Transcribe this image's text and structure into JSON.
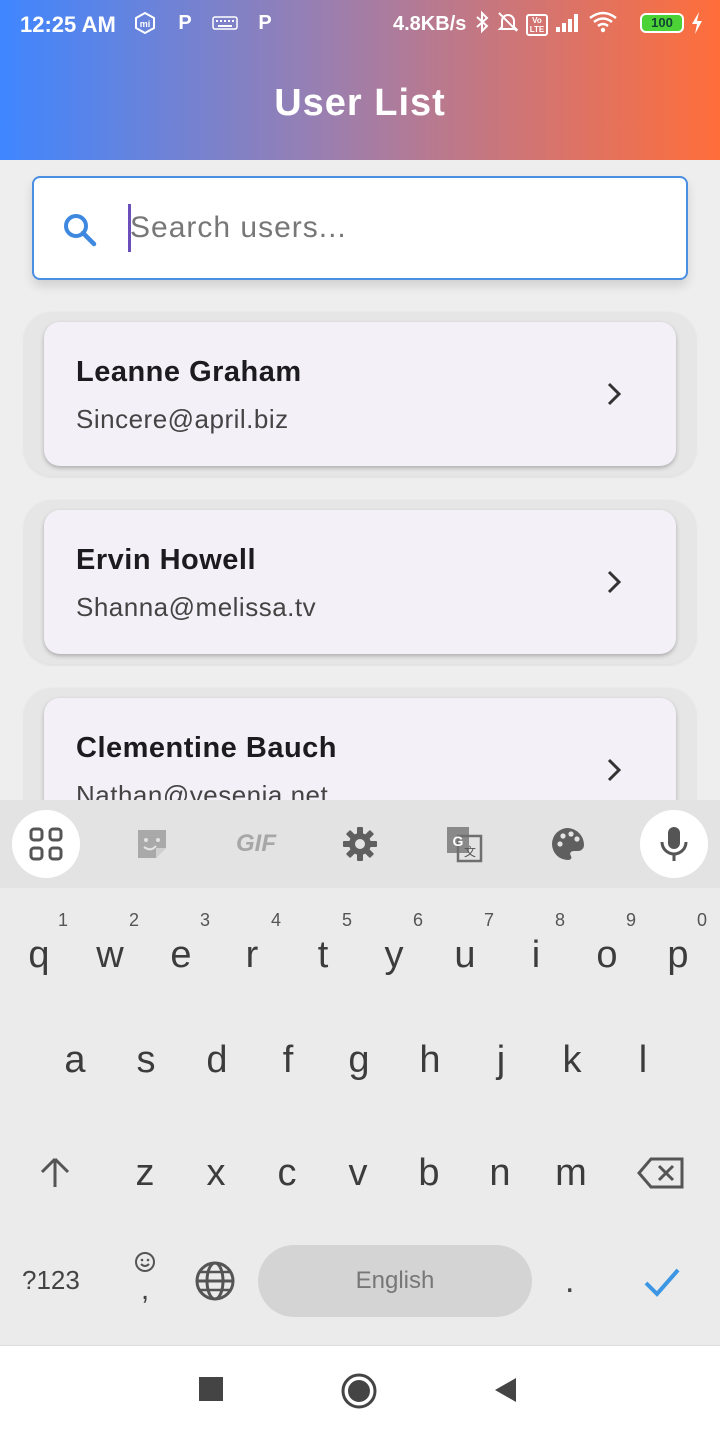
{
  "status_bar": {
    "time": "12:25 AM",
    "speed": "4.8KB/s",
    "battery": "100",
    "p_icon_1": "P",
    "p_icon_2": "P",
    "volte": "Vo LTE",
    "icons": [
      "mi-icon",
      "p-icon",
      "keyboard-icon",
      "p-icon",
      "bluetooth-icon",
      "mute-bell-icon",
      "volte-icon",
      "signal-icon",
      "wifi-icon",
      "battery-icon",
      "charging-icon"
    ]
  },
  "header": {
    "title": "User List"
  },
  "search": {
    "placeholder": "Search users..."
  },
  "users": [
    {
      "name": "Leanne Graham",
      "email": "Sincere@april.biz"
    },
    {
      "name": "Ervin Howell",
      "email": "Shanna@melissa.tv"
    },
    {
      "name": "Clementine Bauch",
      "email": "Nathan@yesenia.net"
    }
  ],
  "keyboard": {
    "toolbar": {
      "gif": "GIF"
    },
    "row1": [
      {
        "key": "q",
        "hint": "1"
      },
      {
        "key": "w",
        "hint": "2"
      },
      {
        "key": "e",
        "hint": "3"
      },
      {
        "key": "r",
        "hint": "4"
      },
      {
        "key": "t",
        "hint": "5"
      },
      {
        "key": "y",
        "hint": "6"
      },
      {
        "key": "u",
        "hint": "7"
      },
      {
        "key": "i",
        "hint": "8"
      },
      {
        "key": "o",
        "hint": "9"
      },
      {
        "key": "p",
        "hint": "0"
      }
    ],
    "row2": [
      "a",
      "s",
      "d",
      "f",
      "g",
      "h",
      "j",
      "k",
      "l"
    ],
    "row3": [
      "z",
      "x",
      "c",
      "v",
      "b",
      "n",
      "m"
    ],
    "symbols_label": "?123",
    "comma": ",",
    "space_label": "English",
    "period": "."
  },
  "colors": {
    "accent": "#4a8fe2",
    "caret": "#6b4fbb",
    "check": "#3b97e3"
  }
}
